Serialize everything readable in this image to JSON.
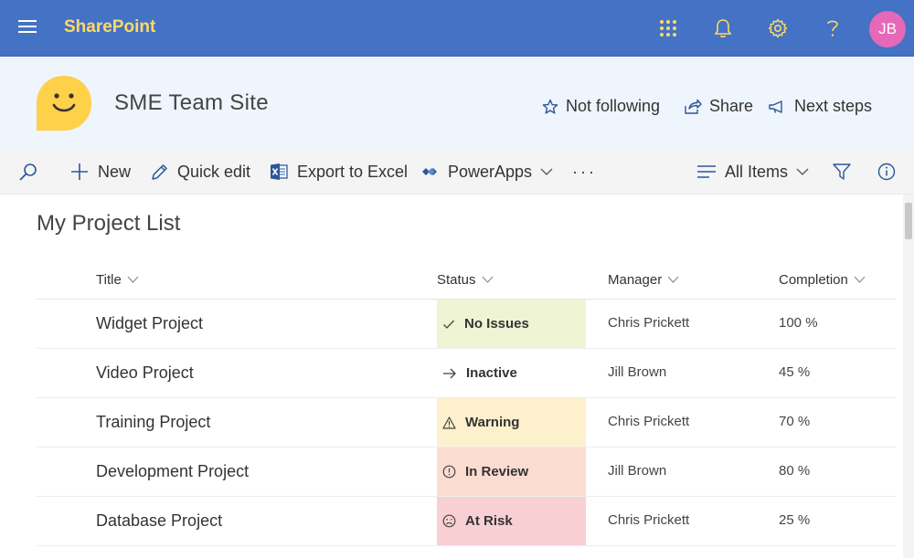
{
  "suitebar": {
    "brand": "SharePoint",
    "avatar_initials": "JB",
    "icons": [
      "app-launcher-icon",
      "bell-icon",
      "gear-icon",
      "help-icon"
    ]
  },
  "site": {
    "title": "SME Team Site",
    "actions": {
      "follow": "Not following",
      "share": "Share",
      "next_steps": "Next steps"
    }
  },
  "commandbar": {
    "new": "New",
    "quick_edit": "Quick edit",
    "export": "Export to Excel",
    "powerapps": "PowerApps",
    "overflow": "···",
    "view": "All Items"
  },
  "list": {
    "title": "My Project List",
    "columns": {
      "title": "Title",
      "status": "Status",
      "manager": "Manager",
      "completion": "Completion"
    },
    "rows": [
      {
        "title": "Widget Project",
        "status": "No Issues",
        "status_icon": "check-icon",
        "status_color": "#eef4d4",
        "manager": "Chris Prickett",
        "completion": "100 %"
      },
      {
        "title": "Video Project",
        "status": "Inactive",
        "status_icon": "arrow-right-icon",
        "status_color": "#ffffff",
        "manager": "Jill Brown",
        "completion": "45 %"
      },
      {
        "title": "Training Project",
        "status": "Warning",
        "status_icon": "warning-icon",
        "status_color": "#fdf0cc",
        "manager": "Chris Prickett",
        "completion": "70 %"
      },
      {
        "title": "Development Project",
        "status": "In Review",
        "status_icon": "info-circle-icon",
        "status_color": "#fbdcd0",
        "manager": "Jill Brown",
        "completion": "80 %"
      },
      {
        "title": "Database Project",
        "status": "At Risk",
        "status_icon": "sad-face-icon",
        "status_color": "#f8d0d3",
        "manager": "Chris Prickett",
        "completion": "25 %"
      }
    ]
  },
  "colors": {
    "suitebar_bg": "#4472c4",
    "brand": "#ffd966",
    "avatar": "#e668b8",
    "site_logo": "#ffd04a",
    "accent": "#2b579a"
  }
}
